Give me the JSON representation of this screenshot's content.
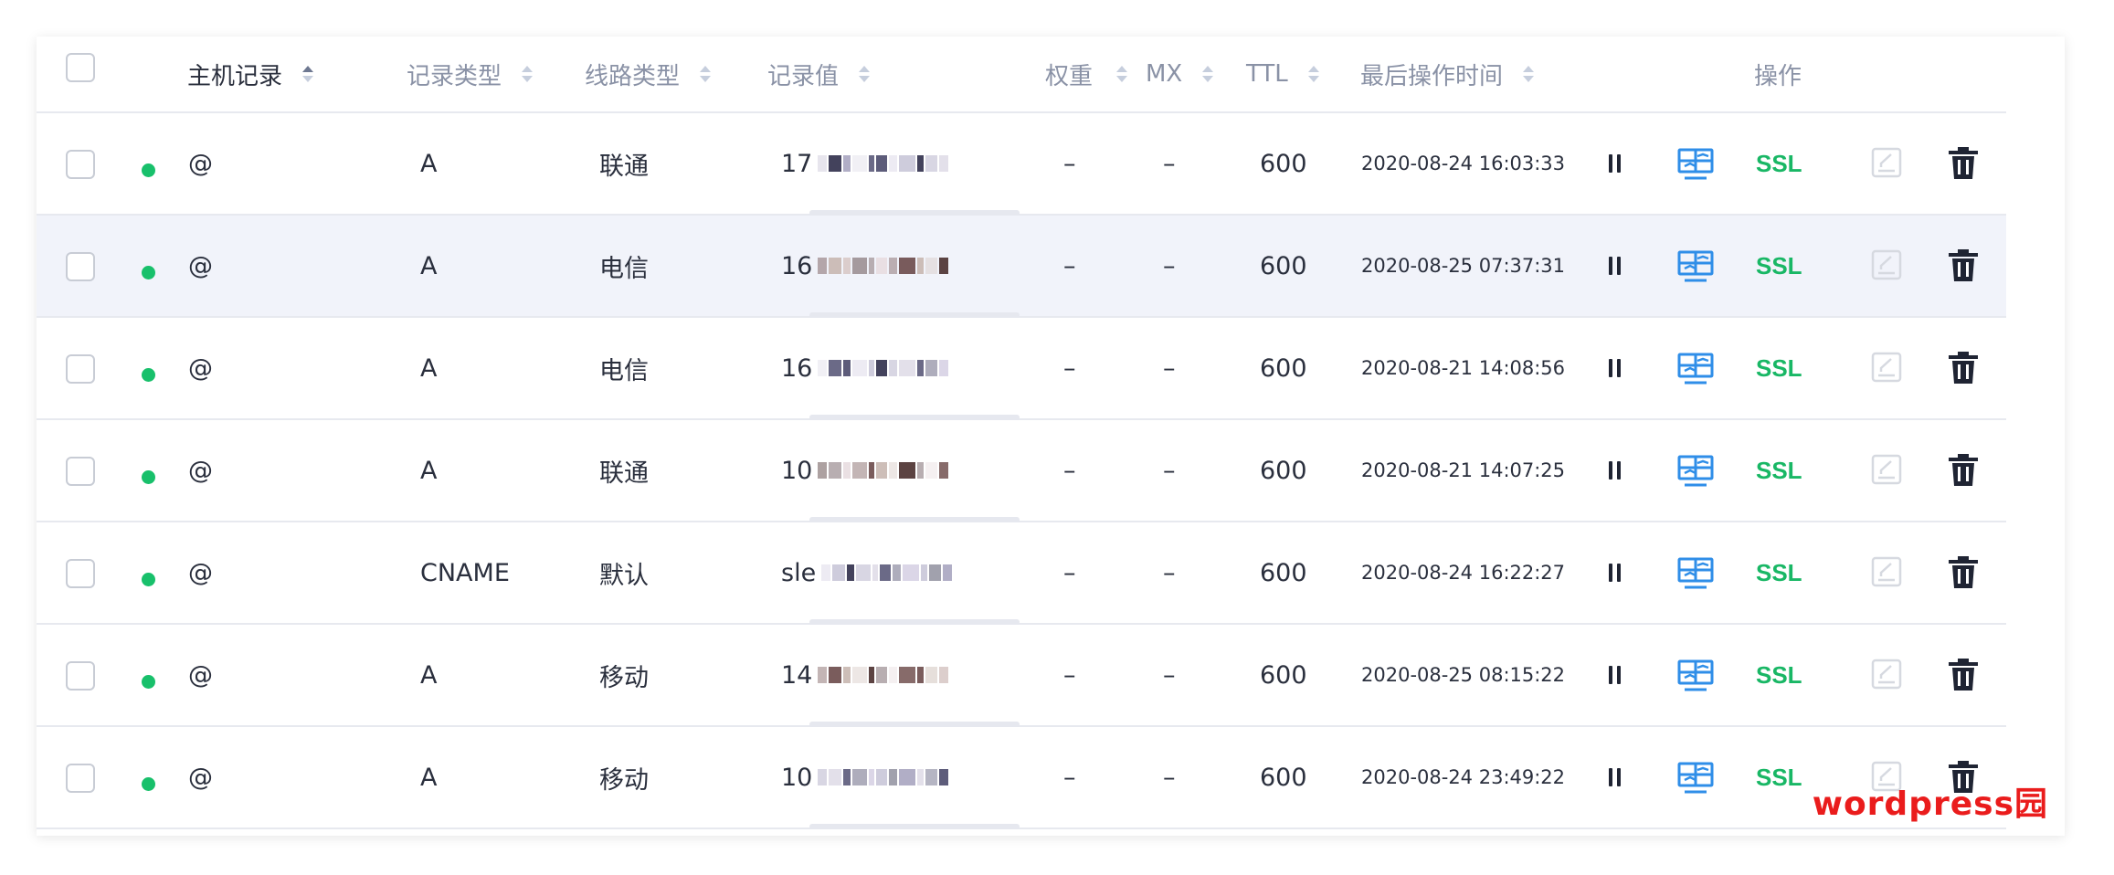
{
  "table": {
    "header": {
      "host": "主机记录",
      "type": "记录类型",
      "line": "线路类型",
      "value": "记录值",
      "weight": "权重",
      "mx": "MX",
      "ttl": "TTL",
      "updated": "最后操作时间",
      "actions": "操作"
    },
    "rows": [
      {
        "host": "@",
        "type": "A",
        "line": "联通",
        "value": "17",
        "weight": "–",
        "mx": "–",
        "ttl": "600",
        "updated": "2020-08-24 16:03:33",
        "ssl": "SSL",
        "highlight": false
      },
      {
        "host": "@",
        "type": "A",
        "line": "电信",
        "value": "16",
        "weight": "–",
        "mx": "–",
        "ttl": "600",
        "updated": "2020-08-25 07:37:31",
        "ssl": "SSL",
        "highlight": true
      },
      {
        "host": "@",
        "type": "A",
        "line": "电信",
        "value": "16",
        "weight": "–",
        "mx": "–",
        "ttl": "600",
        "updated": "2020-08-21 14:08:56",
        "ssl": "SSL",
        "highlight": false
      },
      {
        "host": "@",
        "type": "A",
        "line": "联通",
        "value": "10",
        "weight": "–",
        "mx": "–",
        "ttl": "600",
        "updated": "2020-08-21 14:07:25",
        "ssl": "SSL",
        "highlight": false
      },
      {
        "host": "@",
        "type": "CNAME",
        "line": "默认",
        "value": "sle",
        "weight": "–",
        "mx": "–",
        "ttl": "600",
        "updated": "2020-08-24 16:22:27",
        "ssl": "SSL",
        "highlight": false
      },
      {
        "host": "@",
        "type": "A",
        "line": "移动",
        "value": "14",
        "weight": "–",
        "mx": "–",
        "ttl": "600",
        "updated": "2020-08-25 08:15:22",
        "ssl": "SSL",
        "highlight": false
      },
      {
        "host": "@",
        "type": "A",
        "line": "移动",
        "value": "10",
        "weight": "–",
        "mx": "–",
        "ttl": "600",
        "updated": "2020-08-24 23:49:22",
        "ssl": "SSL",
        "highlight": false
      }
    ]
  },
  "icons": {
    "pause": "pause-icon",
    "monitor": "monitor-icon",
    "edit": "edit-icon",
    "delete": "trash-icon"
  },
  "colors": {
    "status_enabled": "#18c06b",
    "ssl": "#19b765",
    "monitor": "#2f8ee8",
    "row_highlight": "#f1f3fa"
  },
  "watermark": "wordpress园"
}
